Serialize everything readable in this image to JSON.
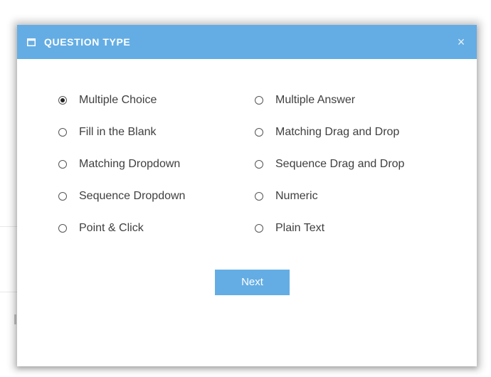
{
  "dialog": {
    "title": "QUESTION TYPE",
    "title_icon": "window-icon",
    "close_label": "×",
    "header_color": "#64ade4",
    "next_label": "Next",
    "selected_option": "Multiple Choice"
  },
  "options": [
    {
      "label": "Multiple Choice",
      "checked": true
    },
    {
      "label": "Multiple Answer",
      "checked": false
    },
    {
      "label": "Fill in the Blank",
      "checked": false
    },
    {
      "label": "Matching Drag and Drop",
      "checked": false
    },
    {
      "label": "Matching Dropdown",
      "checked": false
    },
    {
      "label": "Sequence Drag and Drop",
      "checked": false
    },
    {
      "label": "Sequence Dropdown",
      "checked": false
    },
    {
      "label": "Numeric",
      "checked": false
    },
    {
      "label": "Point & Click",
      "checked": false
    },
    {
      "label": "Plain Text",
      "checked": false
    }
  ]
}
